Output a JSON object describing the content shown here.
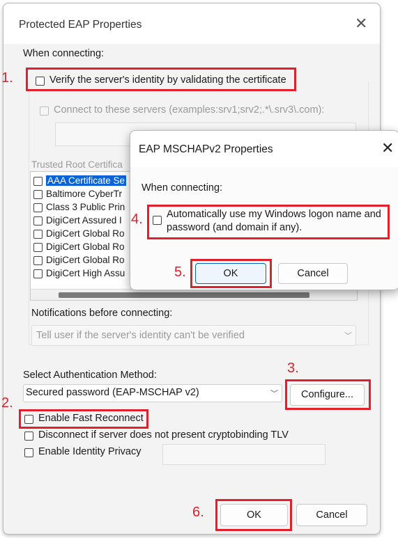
{
  "main": {
    "title": "Protected EAP Properties",
    "when_connecting": "When connecting:",
    "verify_label": "Verify the server's identity by validating the certificate",
    "connect_servers_label": "Connect to these servers (examples:srv1;srv2;.*\\.srv3\\.com):",
    "trusted_root_label": "Trusted Root Certifica",
    "cert_list": [
      {
        "label": "AAA Certificate Se",
        "selected": true
      },
      {
        "label": "Baltimore CyberTr"
      },
      {
        "label": "Class 3 Public Prin"
      },
      {
        "label": "DigiCert Assured I"
      },
      {
        "label": "DigiCert Global Ro"
      },
      {
        "label": "DigiCert Global Ro"
      },
      {
        "label": "DigiCert Global Ro"
      },
      {
        "label": "DigiCert High Assu"
      }
    ],
    "notifications_label": "Notifications before connecting:",
    "notifications_value": "Tell user if the server's identity can't be verified",
    "select_auth_label": "Select Authentication Method:",
    "auth_method_value": "Secured password (EAP-MSCHAP v2)",
    "configure_label": "Configure...",
    "fast_reconnect_label": "Enable Fast Reconnect",
    "disconnect_label": "Disconnect if server does not present cryptobinding TLV",
    "identity_privacy_label": "Enable Identity Privacy",
    "ok_label": "OK",
    "cancel_label": "Cancel"
  },
  "popup": {
    "title": "EAP MSCHAPv2 Properties",
    "when_connecting": "When connecting:",
    "auto_logon_line1": "Automatically use my Windows logon name and",
    "auto_logon_line2": "password (and domain if any).",
    "ok_label": "OK",
    "cancel_label": "Cancel"
  },
  "annotations": {
    "n1": "1.",
    "n2": "2.",
    "n3": "3.",
    "n4": "4.",
    "n5": "5.",
    "n6": "6."
  },
  "icons": {
    "close": "close-icon",
    "dropdown": "chevron-down-icon"
  },
  "colors": {
    "annotation_red": "#e0202a",
    "selection_blue": "#0a64d8",
    "primary_border": "#0067c0"
  }
}
